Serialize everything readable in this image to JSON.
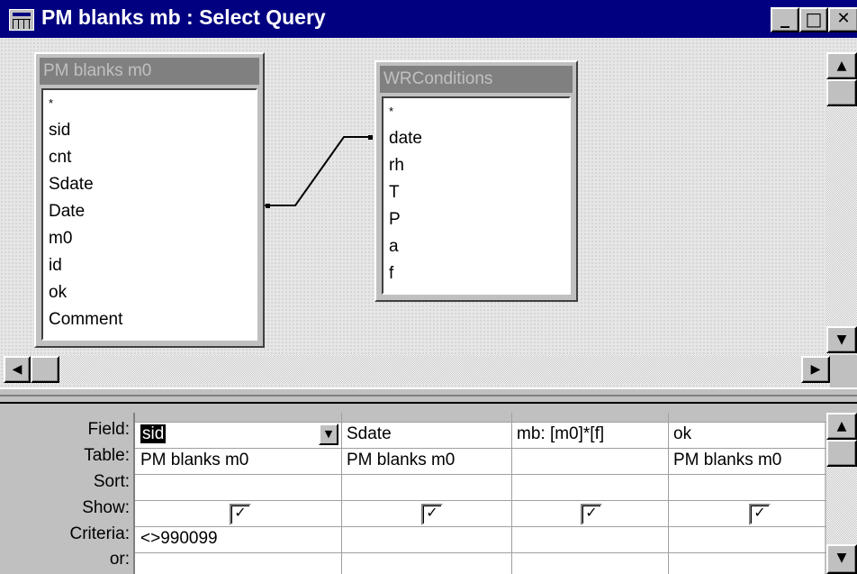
{
  "window": {
    "title": "PM blanks mb : Select Query",
    "minimize_glyph": "_",
    "maximize_glyph": "□",
    "close_glyph": "✕"
  },
  "tables": [
    {
      "name": "PM blanks m0",
      "fields": [
        "*",
        "sid",
        "cnt",
        "Sdate",
        "Date",
        "m0",
        "id",
        "ok",
        "Comment"
      ]
    },
    {
      "name": "WRConditions",
      "fields": [
        "*",
        "date",
        "rh",
        "T",
        "P",
        "a",
        "f"
      ]
    }
  ],
  "grid": {
    "row_labels": {
      "field": "Field:",
      "table": "Table:",
      "sort": "Sort:",
      "show": "Show:",
      "criteria": "Criteria:",
      "or": "or:"
    },
    "columns": [
      {
        "field": "sid",
        "table": "PM blanks m0",
        "sort": "",
        "show": true,
        "criteria": "<>990099",
        "or": ""
      },
      {
        "field": "Sdate",
        "table": "PM blanks m0",
        "sort": "",
        "show": true,
        "criteria": "",
        "or": ""
      },
      {
        "field": "mb: [m0]*[f]",
        "table": "",
        "sort": "",
        "show": true,
        "criteria": "",
        "or": ""
      },
      {
        "field": "ok",
        "table": "PM blanks m0",
        "sort": "",
        "show": true,
        "criteria": "",
        "or": ""
      }
    ],
    "check_glyph": "✓",
    "dropdown_glyph": "▼"
  },
  "scroll_glyphs": {
    "up": "▲",
    "down": "▼",
    "left": "◀",
    "right": "▶"
  },
  "colors": {
    "titlebar": "#000080",
    "face": "#c0c0c0",
    "table_header": "#808080"
  }
}
